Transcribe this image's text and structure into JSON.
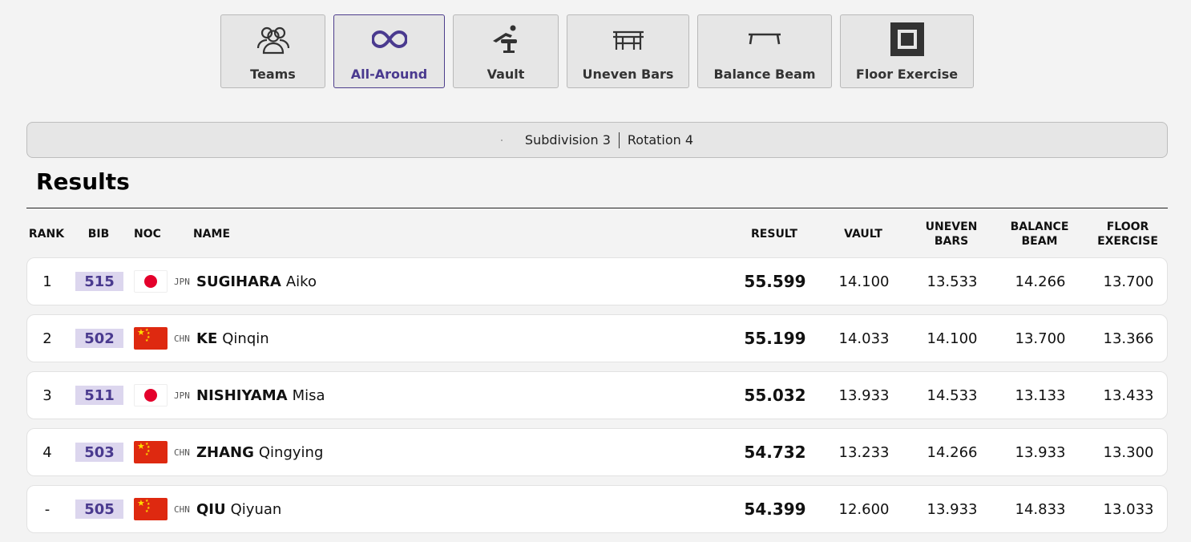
{
  "tabs": [
    {
      "label": "Teams",
      "icon": "teams-icon",
      "active": false
    },
    {
      "label": "All-Around",
      "icon": "infinity-icon",
      "active": true
    },
    {
      "label": "Vault",
      "icon": "vault-icon",
      "active": false
    },
    {
      "label": "Uneven Bars",
      "icon": "uneven-bars-icon",
      "active": false
    },
    {
      "label": "Balance Beam",
      "icon": "balance-beam-icon",
      "active": false
    },
    {
      "label": "Floor Exercise",
      "icon": "floor-exercise-icon",
      "active": false
    }
  ],
  "subdivision": {
    "subdivision": "Subdivision 3",
    "rotation": "Rotation 4"
  },
  "results_title": "Results",
  "table": {
    "headers": {
      "rank": "RANK",
      "bib": "BIB",
      "noc": "NOC",
      "name": "NAME",
      "result": "RESULT",
      "vault": "VAULT",
      "uneven_bars_1": "UNEVEN",
      "uneven_bars_2": "BARS",
      "balance_beam_1": "BALANCE",
      "balance_beam_2": "BEAM",
      "floor_1": "FLOOR",
      "floor_2": "EXERCISE"
    },
    "rows": [
      {
        "rank": "1",
        "bib": "515",
        "noc": "JPN",
        "last": "SUGIHARA",
        "first": "Aiko",
        "result": "55.599",
        "vault": "14.100",
        "uneven_bars": "13.533",
        "balance_beam": "14.266",
        "floor": "13.700"
      },
      {
        "rank": "2",
        "bib": "502",
        "noc": "CHN",
        "last": "KE",
        "first": "Qinqin",
        "result": "55.199",
        "vault": "14.033",
        "uneven_bars": "14.100",
        "balance_beam": "13.700",
        "floor": "13.366"
      },
      {
        "rank": "3",
        "bib": "511",
        "noc": "JPN",
        "last": "NISHIYAMA",
        "first": "Misa",
        "result": "55.032",
        "vault": "13.933",
        "uneven_bars": "14.533",
        "balance_beam": "13.133",
        "floor": "13.433"
      },
      {
        "rank": "4",
        "bib": "503",
        "noc": "CHN",
        "last": "ZHANG",
        "first": "Qingying",
        "result": "54.732",
        "vault": "13.233",
        "uneven_bars": "14.266",
        "balance_beam": "13.933",
        "floor": "13.300"
      },
      {
        "rank": "-",
        "bib": "505",
        "noc": "CHN",
        "last": "QIU",
        "first": "Qiyuan",
        "result": "54.399",
        "vault": "12.600",
        "uneven_bars": "13.933",
        "balance_beam": "14.833",
        "floor": "13.033"
      }
    ]
  },
  "colors": {
    "accent": "#4a3a8f",
    "bib_bg": "#dcd6ee",
    "jpn_red": "#e4002b",
    "chn_red": "#de2910",
    "chn_yellow": "#ffde00"
  }
}
